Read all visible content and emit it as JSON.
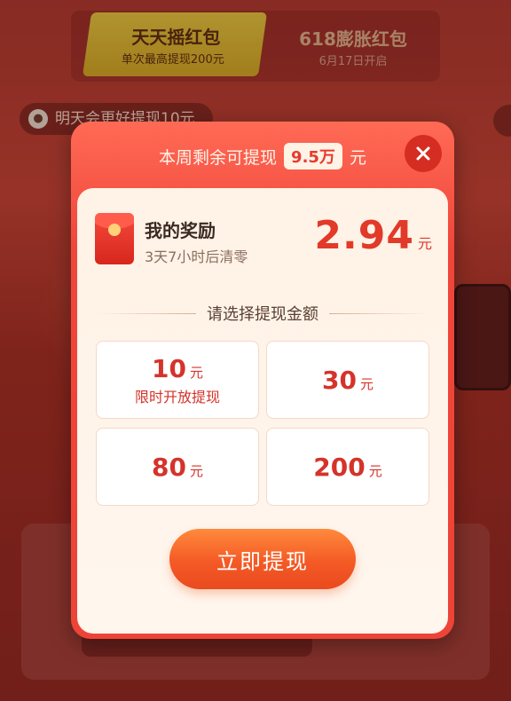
{
  "background": {
    "tabs": [
      {
        "title": "天天摇红包",
        "subtitle": "单次最高提现200元"
      },
      {
        "title": "618膨胀红包",
        "subtitle": "6月17日开启"
      }
    ],
    "hint_text": "明天会更好提现10元"
  },
  "modal": {
    "header_prefix": "本周剩余可提现",
    "header_quota": "9.5万",
    "header_suffix": "元",
    "reward": {
      "title": "我的奖励",
      "subtitle": "3天7小时后清零",
      "amount": "2.94",
      "unit": "元"
    },
    "select_label": "请选择提现金额",
    "options": [
      {
        "value": "10",
        "unit": "元",
        "note": "限时开放提现"
      },
      {
        "value": "30",
        "unit": "元"
      },
      {
        "value": "80",
        "unit": "元"
      },
      {
        "value": "200",
        "unit": "元"
      }
    ],
    "withdraw_label": "立即提现"
  },
  "colors": {
    "accent": "#ee4437",
    "amount_red": "#e23a28",
    "button_orange": "#f45a25"
  }
}
